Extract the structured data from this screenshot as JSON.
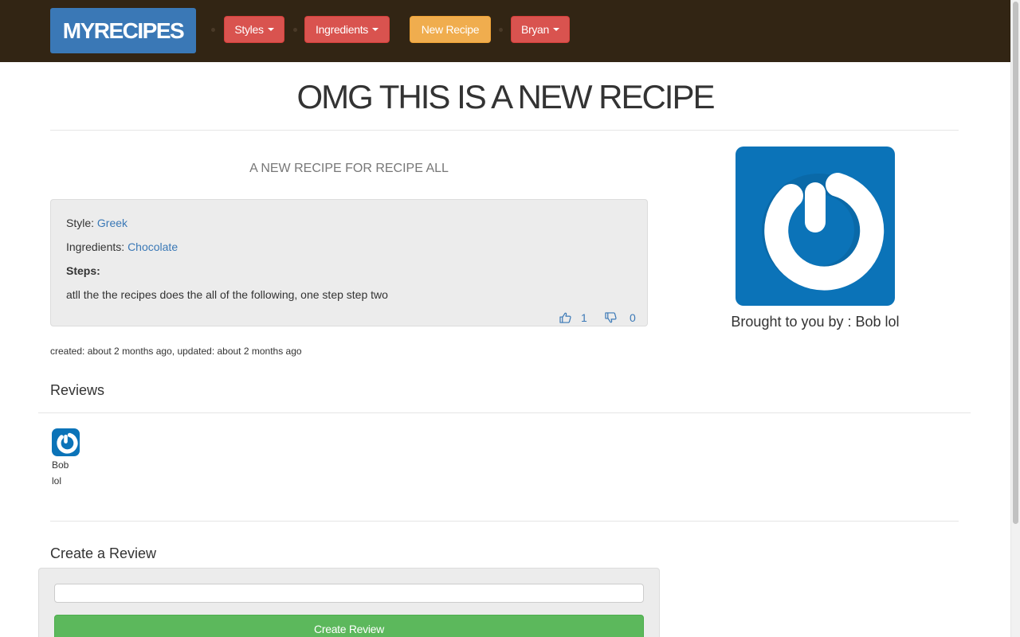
{
  "navbar": {
    "brand": "MYRECIPES",
    "styles_label": "Styles",
    "ingredients_label": "Ingredients",
    "new_recipe_label": "New Recipe",
    "user_label": "Bryan"
  },
  "recipe": {
    "title": "OMG THIS IS A NEW RECIPE",
    "description": "A NEW RECIPE FOR RECIPE ALL",
    "style_label": "Style:",
    "style_value": "Greek",
    "ingredients_label": "Ingredients:",
    "ingredients_value": "Chocolate",
    "steps_label": "Steps:",
    "steps_text": "atll the the recipes does the all of the following, one step step two",
    "likes": "1",
    "dislikes": "0",
    "timestamps": "created: about 2 months ago, updated: about 2 months ago"
  },
  "chef": {
    "byline": "Brought to you by : Bob lol"
  },
  "reviews": {
    "heading": "Reviews",
    "items": [
      {
        "first_name": "Bob",
        "last_name": "lol"
      }
    ]
  },
  "create_review": {
    "heading": "Create a Review",
    "input_value": "",
    "submit_label": "Create Review"
  },
  "colors": {
    "navbar_bg": "#322514",
    "brand_bg": "#3a78b6",
    "danger": "#d9534f",
    "warning": "#f0ad4e",
    "success": "#5cb85c",
    "link": "#3a78b6",
    "avatar_bg": "#0b73b8"
  },
  "icons": {
    "like": "thumbs-up-icon",
    "dislike": "thumbs-down-icon",
    "avatar": "power-logo-icon"
  }
}
